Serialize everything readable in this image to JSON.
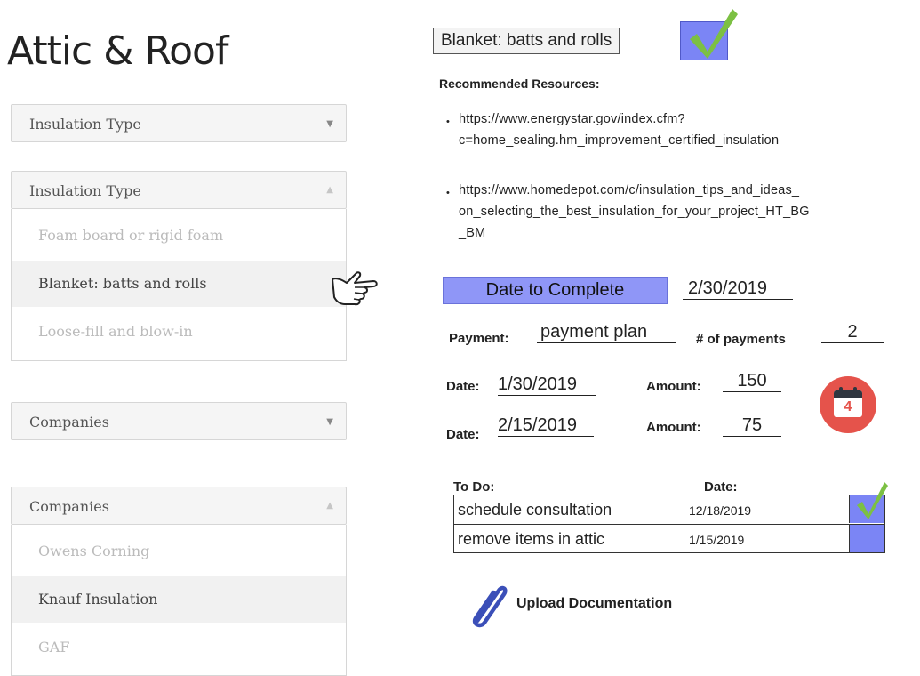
{
  "page_title": "Attic & Roof",
  "insulation_dropdown": {
    "label": "Insulation Type"
  },
  "insulation_open": {
    "label": "Insulation Type",
    "options": [
      "Foam board or rigid foam",
      "Blanket: batts and rolls",
      "Loose-fill and blow-in"
    ],
    "highlighted_index": 1
  },
  "companies_dropdown": {
    "label": "Companies"
  },
  "companies_open": {
    "label": "Companies",
    "options": [
      "Owens Corning",
      "Knauf Insulation",
      "GAF"
    ],
    "highlighted_index": 1
  },
  "selection": {
    "value": "Blanket: batts and rolls",
    "checked": true
  },
  "resources": {
    "heading": "Recommended Resources:",
    "links": [
      {
        "line1": "https://www.energystar.gov/index.cfm?",
        "line2": "c=home_sealing.hm_improvement_certified_insulation",
        "line3": ""
      },
      {
        "line1": "https://www.homedepot.com/c/insulation_tips_and_ideas_",
        "line2": "on_selecting_the_best_insulation_for_your_project_HT_BG",
        "line3": "_BM"
      }
    ]
  },
  "schedule": {
    "button_label": "Date to Complete",
    "date_value": "2/30/2019",
    "payment_label": "Payment:",
    "payment_value": "payment plan",
    "num_payments_label": "# of payments",
    "num_payments_value": "2",
    "installments": [
      {
        "date_label": "Date:",
        "date": "1/30/2019",
        "amount_label": "Amount:",
        "amount": "150"
      },
      {
        "date_label": "Date:",
        "date": "2/15/2019",
        "amount_label": "Amount:",
        "amount": "75"
      }
    ],
    "calendar_day": "4"
  },
  "todo": {
    "col_task": "To Do:",
    "col_date": "Date:",
    "rows": [
      {
        "task": "schedule consultation",
        "date": "12/18/2019",
        "done": true
      },
      {
        "task": "remove items in attic",
        "date": "1/15/2019",
        "done": false
      }
    ]
  },
  "upload": {
    "label": "Upload Documentation"
  },
  "colors": {
    "accent_blue": "#7b85f5",
    "check_green": "#7cc043",
    "calendar_red": "#e5534b"
  },
  "icons": [
    "chevron-down-icon",
    "chevron-up-icon",
    "pointing-hand-icon",
    "checkmark-icon",
    "calendar-icon",
    "paperclip-icon"
  ]
}
